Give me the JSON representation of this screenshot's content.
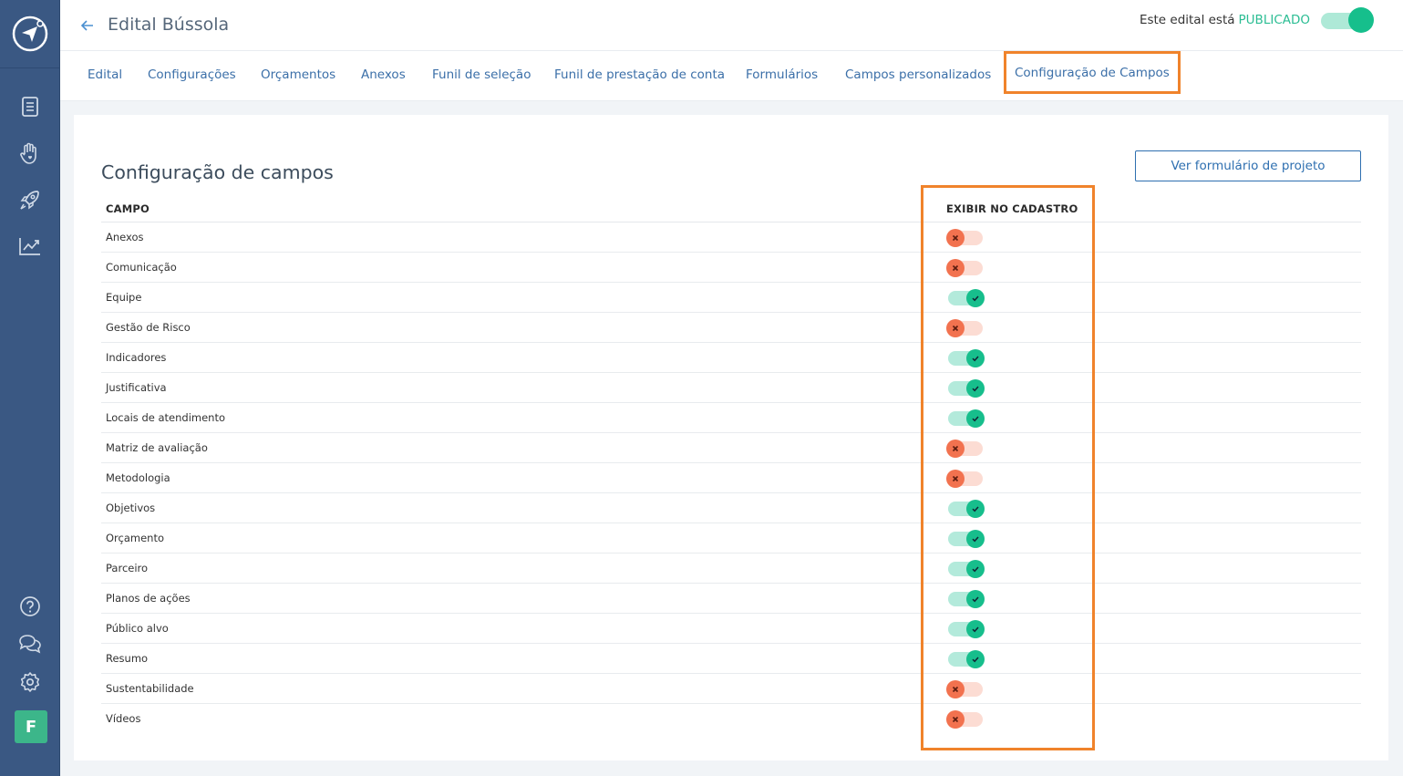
{
  "header": {
    "title": "Edital Bússola",
    "publish_label": "Este edital está",
    "publish_status": "PUBLICADO",
    "publish_on": true
  },
  "sidebar": {
    "avatar_initial": "F",
    "icons": [
      "document-icon",
      "hand-heart-icon",
      "rocket-icon",
      "chart-icon",
      "help-icon",
      "chat-icon",
      "gear-icon"
    ]
  },
  "tabs": [
    {
      "label": "Edital",
      "active": false
    },
    {
      "label": "Configurações",
      "active": false
    },
    {
      "label": "Orçamentos",
      "active": false
    },
    {
      "label": "Anexos",
      "active": false
    },
    {
      "label": "Funil de seleção",
      "active": false
    },
    {
      "label": "Funil de prestação de conta",
      "active": false
    },
    {
      "label": "Formulários",
      "active": false
    },
    {
      "label": "Campos personalizados",
      "active": false
    },
    {
      "label": "Configuração de Campos",
      "active": true
    }
  ],
  "main": {
    "title": "Configuração de campos",
    "view_button": "Ver formulário de projeto",
    "columns": [
      "CAMPO",
      "EXIBIR NO CADASTRO"
    ],
    "rows": [
      {
        "name": "Anexos",
        "show": false
      },
      {
        "name": "Comunicação",
        "show": false
      },
      {
        "name": "Equipe",
        "show": true
      },
      {
        "name": "Gestão de Risco",
        "show": false
      },
      {
        "name": "Indicadores",
        "show": true
      },
      {
        "name": "Justificativa",
        "show": true
      },
      {
        "name": "Locais de atendimento",
        "show": true
      },
      {
        "name": "Matriz de avaliação",
        "show": false
      },
      {
        "name": "Metodologia",
        "show": false
      },
      {
        "name": "Objetivos",
        "show": true
      },
      {
        "name": "Orçamento",
        "show": true
      },
      {
        "name": "Parceiro",
        "show": true
      },
      {
        "name": "Planos de ações",
        "show": true
      },
      {
        "name": "Público alvo",
        "show": true
      },
      {
        "name": "Resumo",
        "show": true
      },
      {
        "name": "Sustentabilidade",
        "show": false
      },
      {
        "name": "Vídeos",
        "show": false
      }
    ]
  },
  "colors": {
    "sidebar": "#3a5883",
    "accent": "#2e6fb0",
    "on": "#17be8c",
    "off": "#f2724f",
    "highlight": "#f0832b"
  }
}
